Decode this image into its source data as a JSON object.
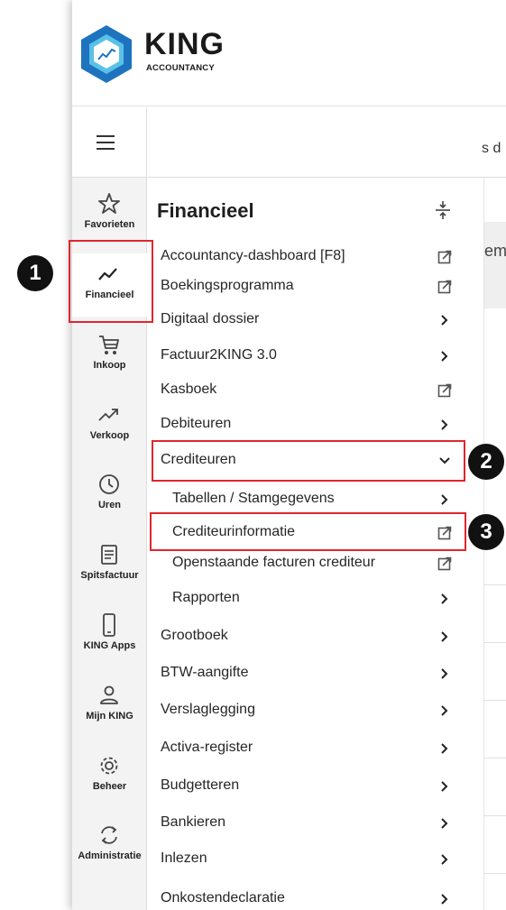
{
  "brand": {
    "name": "KING",
    "subtitle": "ACCOUNTANCY",
    "colors": {
      "hex_outer": "#1e73be",
      "hex_inner": "#59c1e8",
      "text": "#1a1a1a"
    }
  },
  "background": {
    "fragment_top": "s d",
    "fragment_mid": "em"
  },
  "iconbar": {
    "items": [
      {
        "label": "Favorieten",
        "icon": "star-icon"
      },
      {
        "label": "Financieel",
        "icon": "trend-line-icon",
        "active": true
      },
      {
        "label": "Inkoop",
        "icon": "shopping-cart-icon"
      },
      {
        "label": "Verkoop",
        "icon": "trending-up-icon"
      },
      {
        "label": "Uren",
        "icon": "clock-icon"
      },
      {
        "label": "Spitsfactuur",
        "icon": "document-icon"
      },
      {
        "label": "KING Apps",
        "icon": "phone-icon"
      },
      {
        "label": "Mijn KING",
        "icon": "user-icon"
      },
      {
        "label": "Beheer",
        "icon": "gear-icon"
      },
      {
        "label": "Administratie",
        "icon": "sync-icon"
      }
    ]
  },
  "menu": {
    "title": "Financieel",
    "items": [
      {
        "label": "Accountancy-dashboard [F8]",
        "icon": "external-link-icon"
      },
      {
        "label": "Boekingsprogramma",
        "icon": "external-link-icon"
      },
      {
        "label": "Digitaal dossier",
        "icon": "chevron-right-icon"
      },
      {
        "label": "Factuur2KING 3.0",
        "icon": "chevron-right-icon"
      },
      {
        "label": "Kasboek",
        "icon": "external-link-icon"
      },
      {
        "label": "Debiteuren",
        "icon": "chevron-right-icon"
      },
      {
        "label": "Crediteuren",
        "icon": "chevron-down-icon",
        "expanded": true
      },
      {
        "label": "Tabellen / Stamgegevens",
        "icon": "chevron-right-icon",
        "sub": true
      },
      {
        "label": "Crediteurinformatie",
        "icon": "external-link-icon",
        "sub": true
      },
      {
        "label": "Openstaande facturen crediteur",
        "icon": "external-link-icon",
        "sub": true
      },
      {
        "label": "Rapporten",
        "icon": "chevron-right-icon",
        "sub": true
      },
      {
        "label": "Grootboek",
        "icon": "chevron-right-icon"
      },
      {
        "label": "BTW-aangifte",
        "icon": "chevron-right-icon"
      },
      {
        "label": "Verslaglegging",
        "icon": "chevron-right-icon"
      },
      {
        "label": "Activa-register",
        "icon": "chevron-right-icon"
      },
      {
        "label": "Budgetteren",
        "icon": "chevron-right-icon"
      },
      {
        "label": "Bankieren",
        "icon": "chevron-right-icon"
      },
      {
        "label": "Inlezen",
        "icon": "chevron-right-icon"
      },
      {
        "label": "Onkostendeclaratie",
        "icon": "chevron-right-icon"
      }
    ]
  },
  "annotations": [
    {
      "number": "1",
      "target": "Financieel"
    },
    {
      "number": "2",
      "target": "Crediteuren"
    },
    {
      "number": "3",
      "target": "Crediteurinformatie"
    }
  ],
  "colors": {
    "highlight": "#e0262e",
    "badge": "#111111",
    "iconbar_bg": "#f3f3f3"
  }
}
